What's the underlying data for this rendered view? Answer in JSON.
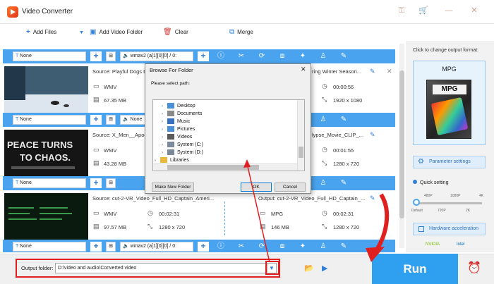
{
  "window": {
    "title": "Video Converter",
    "controls": [
      "key-icon",
      "cart-icon",
      "minimize-icon",
      "close-icon"
    ]
  },
  "toolbar": {
    "add_files": "Add Files",
    "add_video_folder": "Add Video Folder",
    "clear": "Clear",
    "merge": "Merge"
  },
  "rows": [
    {
      "subtitle": "None",
      "audio": "wmav2 (a[1][0][0] / 0:"
    },
    {
      "subtitle": "None",
      "audio": "None"
    },
    {
      "subtitle": "None",
      "audio": "wmav2 (a[1][0][0] / 0:"
    },
    {
      "subtitle": "None",
      "audio": "wmav2 (a[1][0][0] / 0:"
    }
  ],
  "files": [
    {
      "source": "Source: Playful Dogs D",
      "format": "WMV",
      "size": "67.35 MB",
      "output_name": "ring Winter Season...",
      "duration": "00:00:56",
      "resolution": "1920 x 1080"
    },
    {
      "source": "Source: X_Men__Apoc",
      "format": "WMV",
      "size": "43.28 MB",
      "output_name": "lypse_Movie_CLIP_...",
      "duration": "00:01:55",
      "resolution": "1280 x 720",
      "thumb_text_1": "PEACE TURNS",
      "thumb_text_2": "TO CHAOS."
    },
    {
      "source": "Source: cut-2-VR_Video_Full_HD_Captain_Ameri...",
      "format": "WMV",
      "size": "97.57 MB",
      "src_duration": "00:02:31",
      "src_resolution": "1280 x 720",
      "output_name": "Output: cut-2-VR_Video_Full_HD_Captain_...",
      "out_format": "MPG",
      "out_duration": "00:02:31",
      "out_size": "146 MB",
      "out_resolution": "1280 x 720"
    }
  ],
  "right_panel": {
    "hint": "Click to change output format:",
    "format": "MPG",
    "format_art_label": "MPG",
    "parameter_settings": "Parameter settings",
    "quick_setting": "Quick setting",
    "quality_marks_top": [
      "480P",
      "1080P",
      "4K"
    ],
    "quality_marks_bottom": [
      "Default",
      "720P",
      "2K"
    ],
    "quality_level": 0,
    "hardware_acceleration": "Hardware acceleration",
    "brands": [
      "NVIDIA",
      "Intel"
    ]
  },
  "bottom": {
    "output_label": "Output folder:",
    "output_path": "D:\\video and audio\\Converted video",
    "run": "Run"
  },
  "dialog": {
    "title": "Browse For Folder",
    "prompt": "Please select path:",
    "tree": [
      {
        "label": "Desktop",
        "icon": "desktop-folder-icon",
        "color": "#4a90d9"
      },
      {
        "label": "Documents",
        "icon": "documents-folder-icon",
        "color": "#8a8a8a"
      },
      {
        "label": "Music",
        "icon": "music-folder-icon",
        "color": "#3a70c0"
      },
      {
        "label": "Pictures",
        "icon": "pictures-folder-icon",
        "color": "#4a90d9"
      },
      {
        "label": "Videos",
        "icon": "videos-folder-icon",
        "color": "#5a5a5a"
      },
      {
        "label": "System (C:)",
        "icon": "drive-icon",
        "color": "#7a8a9a"
      },
      {
        "label": "System (D:)",
        "icon": "drive-icon",
        "color": "#7a8a9a"
      },
      {
        "label": "Libraries",
        "icon": "libraries-folder-icon",
        "color": "#e8b840"
      }
    ],
    "new_folder": "Make New Folder",
    "ok": "OK",
    "cancel": "Cancel"
  }
}
